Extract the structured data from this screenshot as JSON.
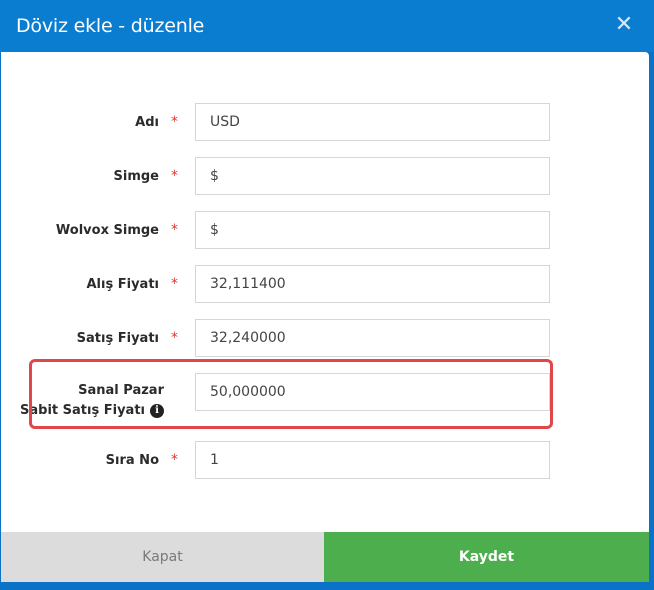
{
  "dialog": {
    "title": "Döviz ekle - düzenle",
    "close_symbol": "✕"
  },
  "required_mark": "*",
  "fields": {
    "name": {
      "label": "Adı",
      "value": "USD",
      "required": true
    },
    "symbol": {
      "label": "Simge",
      "value": "$",
      "required": true
    },
    "wolvox_symbol": {
      "label": "Wolvox Simge",
      "value": "$",
      "required": true
    },
    "buy_price": {
      "label": "Alış Fiyatı",
      "value": "32,111400",
      "required": true
    },
    "sell_price": {
      "label": "Satış Fiyatı",
      "value": "32,240000",
      "required": true
    },
    "marketplace_fixed_sell_price": {
      "label_line1": "Sanal Pazar",
      "label_line2": "Sabit Satış Fiyatı",
      "value": "50,000000",
      "info_icon": "info-circle-icon",
      "info_glyph": "i",
      "required": false
    },
    "order_no": {
      "label": "Sıra No",
      "value": "1",
      "required": true
    }
  },
  "footer": {
    "close_label": "Kapat",
    "save_label": "Kaydet"
  },
  "colors": {
    "header": "#0a7dd1",
    "save_button": "#4cae4c",
    "close_button": "#dcdcdc",
    "highlight_border": "#e0474b",
    "required_star": "#e0362e"
  }
}
